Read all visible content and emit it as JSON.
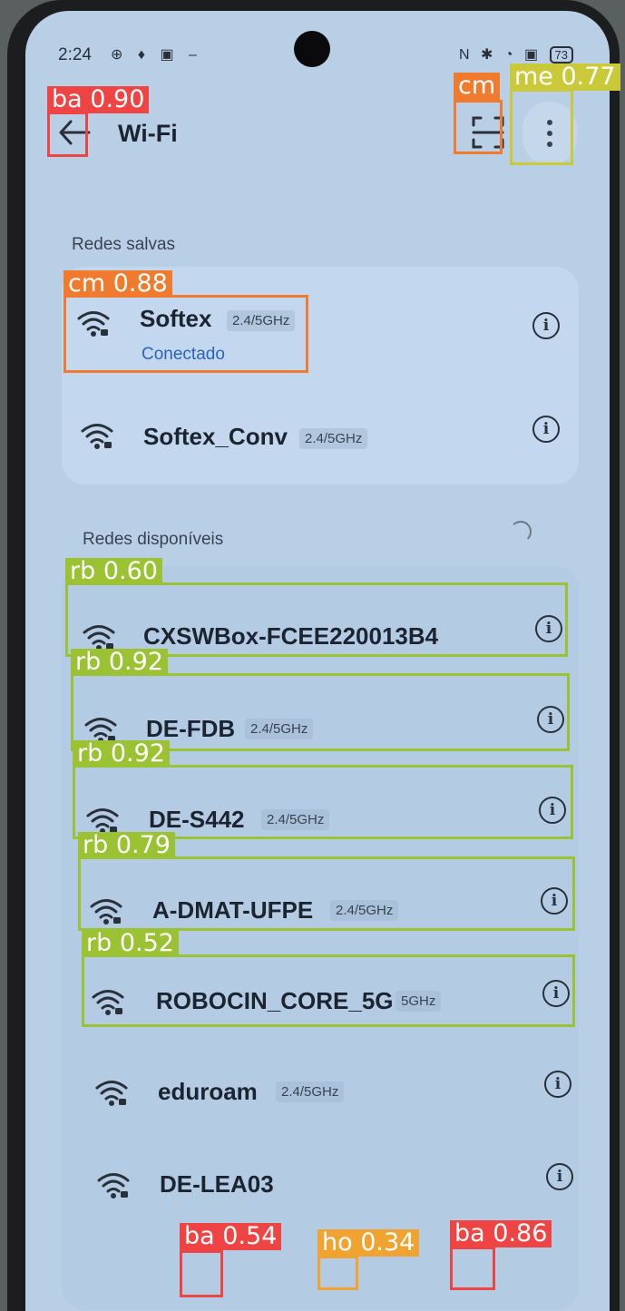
{
  "status_bar": {
    "time": "2:24",
    "left_icons": "⊕ ♦ ▣ –",
    "right_icons": "N ✱ ◔ ▣",
    "battery": "73"
  },
  "header": {
    "title": "Wi-Fi"
  },
  "saved": {
    "label": "Redes salvas",
    "networks": [
      {
        "name": "Softex",
        "band": "2.4/5GHz",
        "status": "Conectado"
      },
      {
        "name": "Softex_Conv",
        "band": "2.4/5GHz"
      }
    ]
  },
  "available": {
    "label": "Redes disponíveis",
    "networks": [
      {
        "name": "CXSWBox-FCEE220013B4",
        "band": ""
      },
      {
        "name": "DE-FDB",
        "band": "2.4/5GHz"
      },
      {
        "name": "DE-S442",
        "band": "2.4/5GHz"
      },
      {
        "name": "A-DMAT-UFPE",
        "band": "2.4/5GHz"
      },
      {
        "name": "ROBOCIN_CORE_5G",
        "band": "5GHz"
      },
      {
        "name": "eduroam",
        "band": "2.4/5GHz"
      },
      {
        "name": "DE-LEA03",
        "band": ""
      }
    ]
  },
  "info_glyph": "i",
  "detections": [
    {
      "label": "ba 0.90",
      "color": "#ee4444"
    },
    {
      "label": "cm",
      "color": "#f07a2e"
    },
    {
      "label": "me 0.77",
      "color": "#c9c93a"
    },
    {
      "label": "cm 0.88",
      "color": "#f07a2e"
    },
    {
      "label": "rb 0.60",
      "color": "#9ac232"
    },
    {
      "label": "rb 0.92",
      "color": "#9ac232"
    },
    {
      "label": "rb 0.92",
      "color": "#9ac232"
    },
    {
      "label": "rb 0.79",
      "color": "#9ac232"
    },
    {
      "label": "rb 0.52",
      "color": "#9ac232"
    },
    {
      "label": "ba 0.54",
      "color": "#ee4444"
    },
    {
      "label": "ho 0.34",
      "color": "#f0a330"
    },
    {
      "label": "ba 0.86",
      "color": "#ee4444"
    }
  ]
}
